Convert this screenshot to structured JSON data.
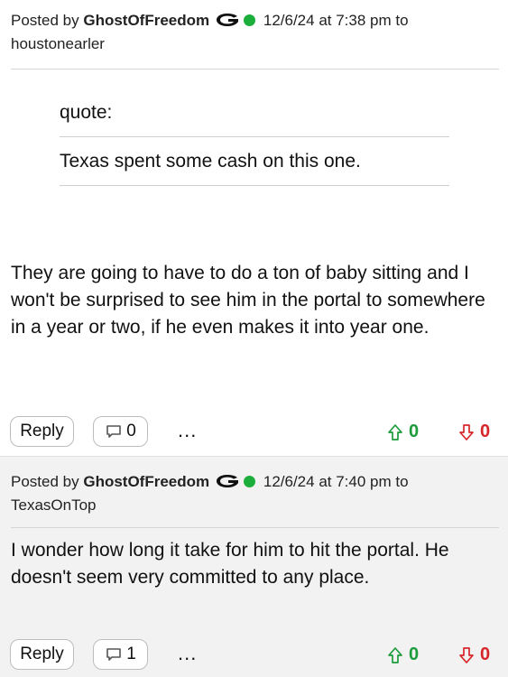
{
  "posts": [
    {
      "posted_by_label": "Posted by",
      "username": "GhostOfFreedom",
      "timestamp": "12/6/24 at 7:38 pm",
      "to_label": "to",
      "reply_to": "houstonearler",
      "quote": {
        "label": "quote:",
        "text": "Texas spent some cash on this one."
      },
      "body": "They are going to have to do a ton of baby sitting and I won't be surprised to see him in the portal to somewhere in a year or two, if he even makes it into year one.",
      "reply_label": "Reply",
      "comment_count": "0",
      "more_label": "...",
      "upvotes": "0",
      "downvotes": "0"
    },
    {
      "posted_by_label": "Posted by",
      "username": "GhostOfFreedom",
      "timestamp": "12/6/24 at 7:40 pm",
      "to_label": "to",
      "reply_to": "TexasOnTop",
      "body": "I wonder how long it take for him to hit the portal. He doesn't seem very committed to any place.",
      "reply_label": "Reply",
      "comment_count": "1",
      "more_label": "...",
      "upvotes": "0",
      "downvotes": "0"
    }
  ],
  "colors": {
    "online": "#1cae3b",
    "upvote": "#1d9b3a",
    "downvote": "#d7262a"
  },
  "icons": [
    "georgia-g-logo-icon",
    "online-status-icon",
    "comment-icon",
    "upvote-arrow-icon",
    "downvote-arrow-icon"
  ]
}
